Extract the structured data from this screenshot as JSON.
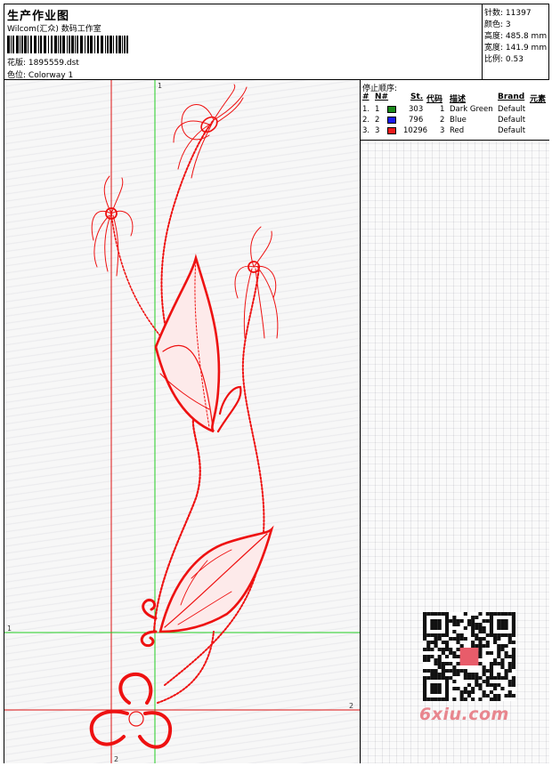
{
  "header": {
    "title": "生产作业图",
    "subtitle": "Wilcom(汇众) 数码工作室",
    "file_label": "花版:",
    "file_value": "1895559.dst",
    "colorway_label": "色位:",
    "colorway_value": "Colorway 1"
  },
  "stats": {
    "stitches_label": "针数:",
    "stitches_value": "11397",
    "colors_label": "颜色:",
    "colors_value": "3",
    "height_label": "高度:",
    "height_value": "485.8 mm",
    "width_label": "宽度:",
    "width_value": "141.9 mm",
    "scale_label": "比例:",
    "scale_value": "0.53"
  },
  "stop_sequence": {
    "label": "停止顺序:",
    "columns": [
      "#",
      "N#",
      "St.",
      "代码",
      "描述",
      "Brand",
      "元素"
    ],
    "rows": [
      {
        "idx": "1.",
        "n": "1",
        "color": "#1a8a1a",
        "st": "303",
        "code": "1",
        "desc": "Dark Green",
        "brand": "Default"
      },
      {
        "idx": "2.",
        "n": "2",
        "color": "#1a1aee",
        "st": "796",
        "code": "2",
        "desc": "Blue",
        "brand": "Default"
      },
      {
        "idx": "3.",
        "n": "3",
        "color": "#ee1a1a",
        "st": "10296",
        "code": "3",
        "desc": "Red",
        "brand": "Default"
      }
    ]
  },
  "guides": {
    "v1_label": "1",
    "h1_label": "1",
    "h2_label": "2",
    "v2_label": "2"
  },
  "watermark": {
    "text": "6xiu.com"
  },
  "colors": {
    "design": "#ee1111",
    "guide_green": "#22cc22",
    "guide_red": "#dd1111"
  }
}
